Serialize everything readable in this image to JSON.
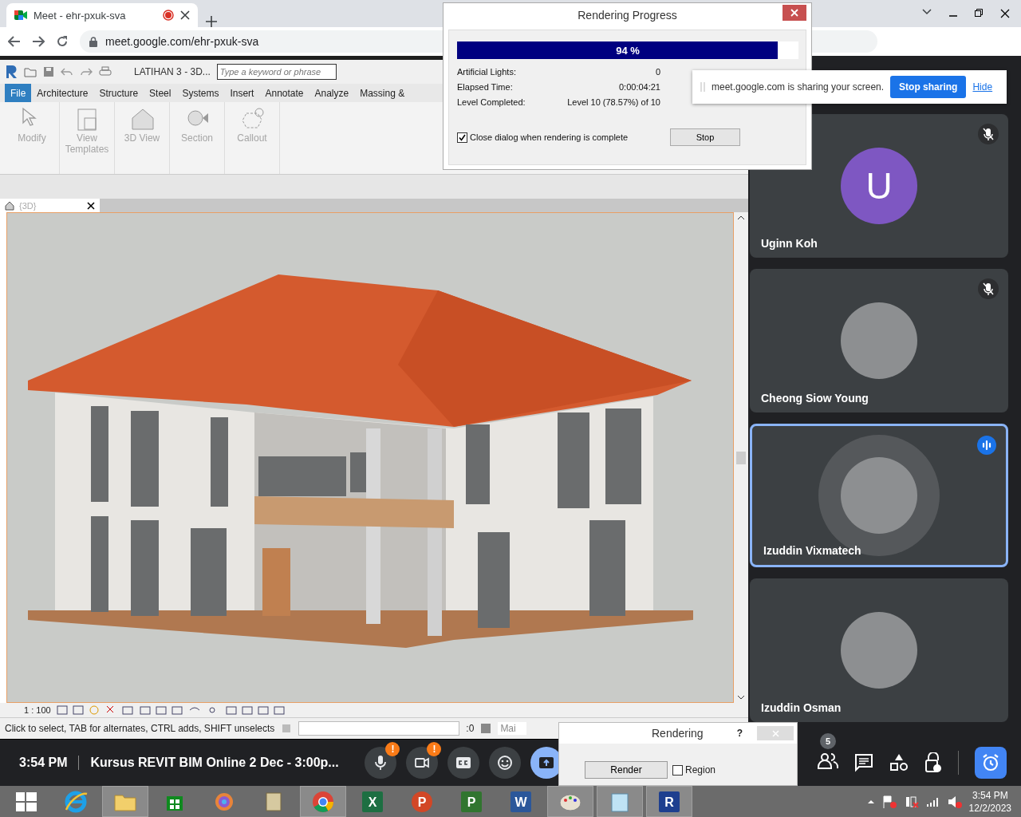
{
  "browser": {
    "tab": {
      "title": "Meet - ehr-pxuk-sva",
      "recording": true
    },
    "url": "meet.google.com/ehr-pxuk-sva"
  },
  "revit": {
    "project_title": "LATIHAN 3 - 3D...",
    "search": {
      "placeholder": "Type a keyword or phrase"
    },
    "ribbon_tabs": [
      {
        "label": "File",
        "selected": true
      },
      {
        "label": "Architecture",
        "selected": false
      },
      {
        "label": "Structure",
        "selected": false
      },
      {
        "label": "Steel",
        "selected": false
      },
      {
        "label": "Systems",
        "selected": false
      },
      {
        "label": "Insert",
        "selected": false
      },
      {
        "label": "Annotate",
        "selected": false
      },
      {
        "label": "Analyze",
        "selected": false
      },
      {
        "label": "Massing &",
        "selected": false
      }
    ],
    "tools": [
      {
        "kind": "pointer",
        "label": "Modify"
      },
      {
        "kind": "template",
        "label": "View Templates"
      },
      {
        "kind": "house",
        "label": "3D View"
      },
      {
        "kind": "section",
        "label": "Section"
      },
      {
        "kind": "callout",
        "label": "Callout"
      }
    ],
    "view_tab": "{3D}",
    "scale": "1 : 100",
    "status": "Click to select, TAB for alternates, CTRL adds, SHIFT unselects",
    "selection_count": ":0",
    "model_field": "Mai"
  },
  "render_dialog": {
    "title": "Rendering Progress",
    "progress": {
      "level": 0.94,
      "reading": "94 %"
    },
    "stats": [
      {
        "label": "Artificial Lights:",
        "value": "0"
      },
      {
        "label": "Elapsed Time:",
        "value": "0:00:04:21"
      },
      {
        "label": "Level Completed:",
        "value": "Level 10 (78.57%) of 10"
      }
    ],
    "close_when_complete": {
      "label": "Close dialog when rendering is complete",
      "checked": true
    },
    "stop_button": "Stop"
  },
  "share_bar": {
    "message": "meet.google.com is sharing your screen.",
    "stop_button": "Stop sharing",
    "hide_link": "Hide"
  },
  "participants": [
    {
      "name": "Uginn Koh",
      "kind": "letter",
      "initial": "U",
      "color": "#7e57c2",
      "muted": true,
      "speaking": false
    },
    {
      "name": "Cheong Siow Young",
      "kind": "photo",
      "muted": true,
      "speaking": false
    },
    {
      "name": "Izuddin Vixmatech",
      "kind": "photo",
      "muted": false,
      "speaking": true
    },
    {
      "name": "Izuddin Osman",
      "kind": "photo",
      "muted": false,
      "speaking": false
    }
  ],
  "meeting_bar": {
    "time": "3:54 PM",
    "title": "Kursus REVIT BIM Online 2 Dec - 3:00p...",
    "controls": [
      {
        "kind": "mic",
        "badge": "!",
        "on": false
      },
      {
        "kind": "camera",
        "badge": "!",
        "on": false
      },
      {
        "kind": "captions",
        "on": false
      },
      {
        "kind": "emoji",
        "on": false
      },
      {
        "kind": "present",
        "on": true
      }
    ],
    "people_count": "5"
  },
  "render_panel": {
    "title": "Rendering",
    "help": "?",
    "render_button": "Render",
    "region": {
      "label": "Region",
      "checked": false
    }
  },
  "taskbar": {
    "apps": [
      {
        "kind": "start",
        "active": false
      },
      {
        "kind": "browser-e",
        "active": false
      },
      {
        "kind": "folder",
        "active": true
      },
      {
        "kind": "store",
        "active": false
      },
      {
        "kind": "swirl",
        "active": false
      },
      {
        "kind": "scroll",
        "active": false
      },
      {
        "kind": "chrome",
        "active": true
      },
      {
        "kind": "tile",
        "letter": "X",
        "color": "#1d6f42",
        "active": false
      },
      {
        "kind": "round",
        "letter": "P",
        "color": "#d24726",
        "active": false
      },
      {
        "kind": "tile",
        "letter": "P",
        "color": "#31752f",
        "active": false
      },
      {
        "kind": "tile",
        "letter": "W",
        "color": "#2b579a",
        "active": false
      },
      {
        "kind": "palette",
        "active": true
      },
      {
        "kind": "notepad",
        "active": true
      },
      {
        "kind": "tile",
        "letter": "R",
        "color": "#1e3f8f",
        "active": true
      }
    ],
    "clock": {
      "time": "3:54 PM",
      "date": "12/2/2023"
    }
  }
}
